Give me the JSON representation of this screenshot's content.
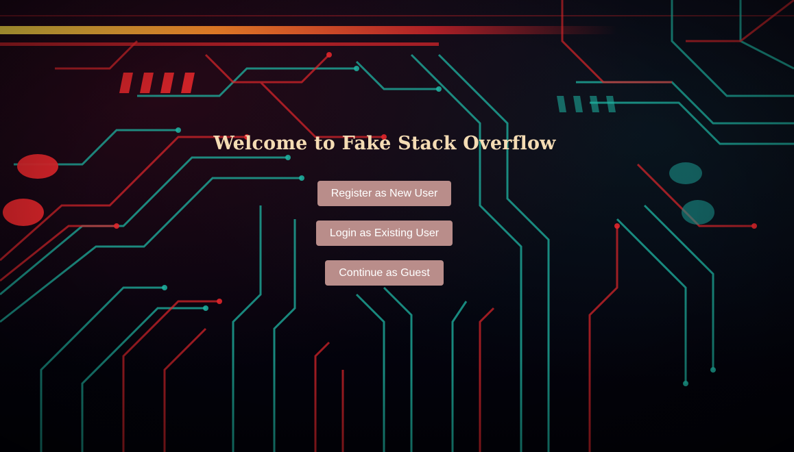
{
  "app": {
    "title": "Welcome to Fake Stack Overflow"
  },
  "actions": {
    "register_label": "Register as New User",
    "login_label": "Login as Existing User",
    "guest_label": "Continue as Guest"
  },
  "colors": {
    "title": "#f4dcb4",
    "button_bg": "#b98d8a",
    "circuit_red": "#e0262b",
    "circuit_teal": "#1fb5a3",
    "glow_yellow": "#ffd84a"
  }
}
